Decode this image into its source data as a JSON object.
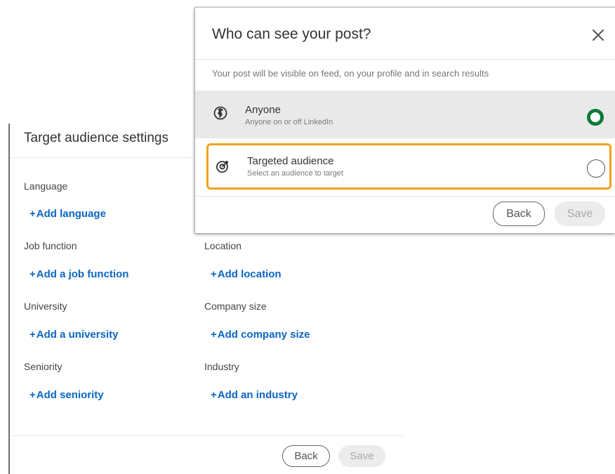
{
  "audience_settings": {
    "title": "Target audience settings",
    "left_fields": [
      {
        "label": "Language",
        "add": "Add language"
      },
      {
        "label": "Job function",
        "add": "Add a job function"
      },
      {
        "label": "University",
        "add": "Add a university"
      },
      {
        "label": "Seniority",
        "add": "Add seniority"
      }
    ],
    "right_fields": [
      {
        "label": "Location",
        "add": "Add location"
      },
      {
        "label": "Company size",
        "add": "Add company size"
      },
      {
        "label": "Industry",
        "add": "Add an industry"
      }
    ],
    "back_label": "Back",
    "save_label": "Save"
  },
  "visibility_dialog": {
    "title": "Who can see your post?",
    "description": "Your post will be visible on feed, on your profile and in search results",
    "options": [
      {
        "title": "Anyone",
        "subtitle": "Anyone on or off LinkedIn",
        "icon": "globe-icon",
        "selected": true
      },
      {
        "title": "Targeted audience",
        "subtitle": "Select an audience to target",
        "icon": "target-icon",
        "selected": false
      }
    ],
    "back_label": "Back",
    "save_label": "Save"
  },
  "colors": {
    "link": "#0a66c2",
    "selected_radio": "#0c7a3a",
    "highlight_border": "#f0a31b",
    "selected_row_bg": "#e9e9e9"
  }
}
